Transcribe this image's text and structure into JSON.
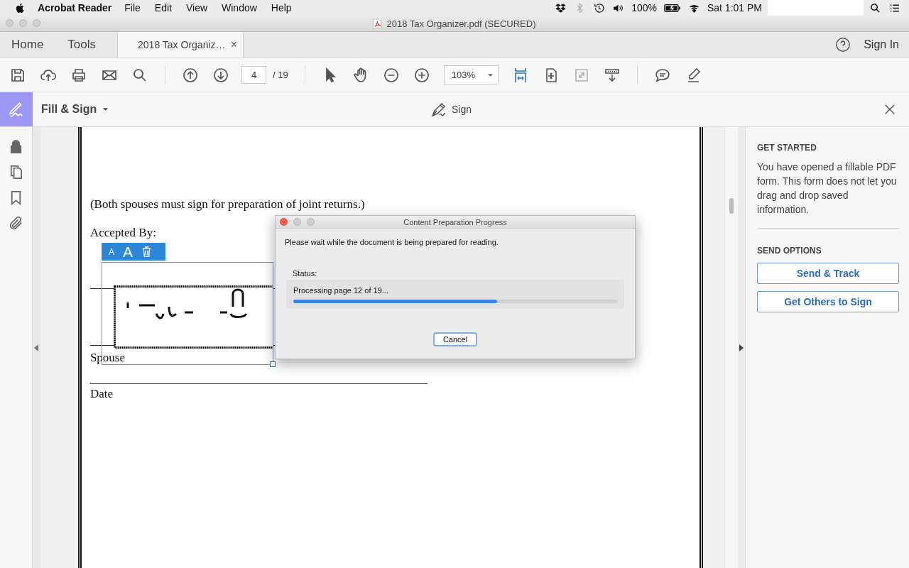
{
  "menubar": {
    "app": "Acrobat Reader",
    "menus": [
      "File",
      "Edit",
      "View",
      "Window",
      "Help"
    ],
    "battery": "100%",
    "clock": "Sat 1:01 PM"
  },
  "window": {
    "title": "2018 Tax Organizer.pdf (SECURED)"
  },
  "nav": [
    "Home",
    "Tools"
  ],
  "tabs": [
    {
      "label": "2018 Tax Organiz…",
      "close": "×",
      "selected": true
    }
  ],
  "help": {
    "sign_in": "Sign In"
  },
  "toolbar": {
    "page": "4",
    "total": "/ 19",
    "zoom": "103%"
  },
  "fill_sign": {
    "title": "Fill & Sign",
    "sign": "Sign"
  },
  "document": {
    "lines": [
      {
        "kind": "text",
        "text": "(Both spouses must sign for preparation of joint returns.)"
      },
      {
        "kind": "text",
        "text": "Accepted By:"
      },
      {
        "kind": "rule"
      },
      {
        "kind": "rule"
      },
      {
        "kind": "text",
        "text": "Spouse"
      },
      {
        "kind": "rule"
      },
      {
        "kind": "text",
        "text": "Date"
      }
    ]
  },
  "signature_toolbar": {
    "smaller": "A",
    "larger": "A"
  },
  "dialog": {
    "title": "Content Preparation Progress",
    "message": "Please wait while the document is being prepared for reading.",
    "status_label": "Status:",
    "status": "Processing page 12 of 19...",
    "level": 0.63,
    "button": "Cancel"
  },
  "panel": {
    "get_started": {
      "heading": "GET STARTED",
      "text": "You have opened a fillable PDF form. This form does not let you drag and drop saved information."
    },
    "send_options": {
      "heading": "SEND OPTIONS",
      "buttons": [
        "Send & Track",
        "Get Others to Sign"
      ]
    }
  }
}
